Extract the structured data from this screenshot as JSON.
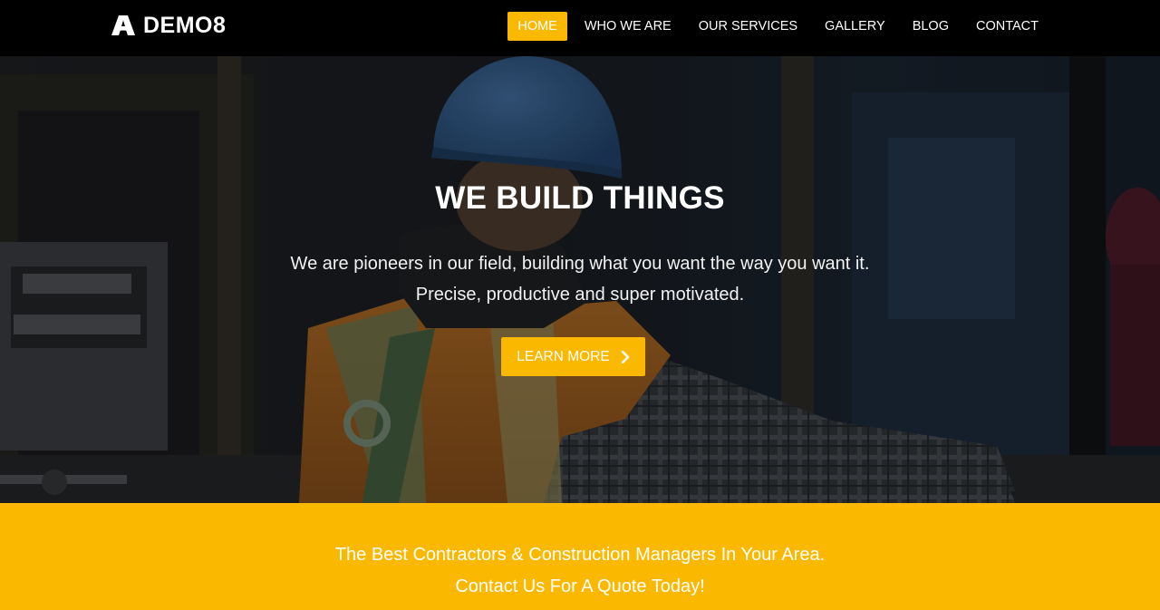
{
  "brand": {
    "name": "DEMO8",
    "icon": "logo-triangle-icon"
  },
  "nav": {
    "items": [
      {
        "label": "HOME",
        "active": true
      },
      {
        "label": "WHO WE ARE",
        "active": false
      },
      {
        "label": "OUR SERVICES",
        "active": false
      },
      {
        "label": "GALLERY",
        "active": false
      },
      {
        "label": "BLOG",
        "active": false
      },
      {
        "label": "CONTACT",
        "active": false
      }
    ]
  },
  "hero": {
    "title": "WE BUILD THINGS",
    "line1": "We are pioneers in our field, building what you want the way you want it.",
    "line2": "Precise, productive and super motivated.",
    "cta_label": "LEARN MORE",
    "cta_icon": "chevron-right-icon"
  },
  "band": {
    "line1": "The Best Contractors & Construction Managers In Your Area.",
    "line2": "Contact Us For A Quote Today!"
  },
  "colors": {
    "accent": "#fbb800",
    "header_bg": "#000000",
    "text": "#ffffff"
  }
}
